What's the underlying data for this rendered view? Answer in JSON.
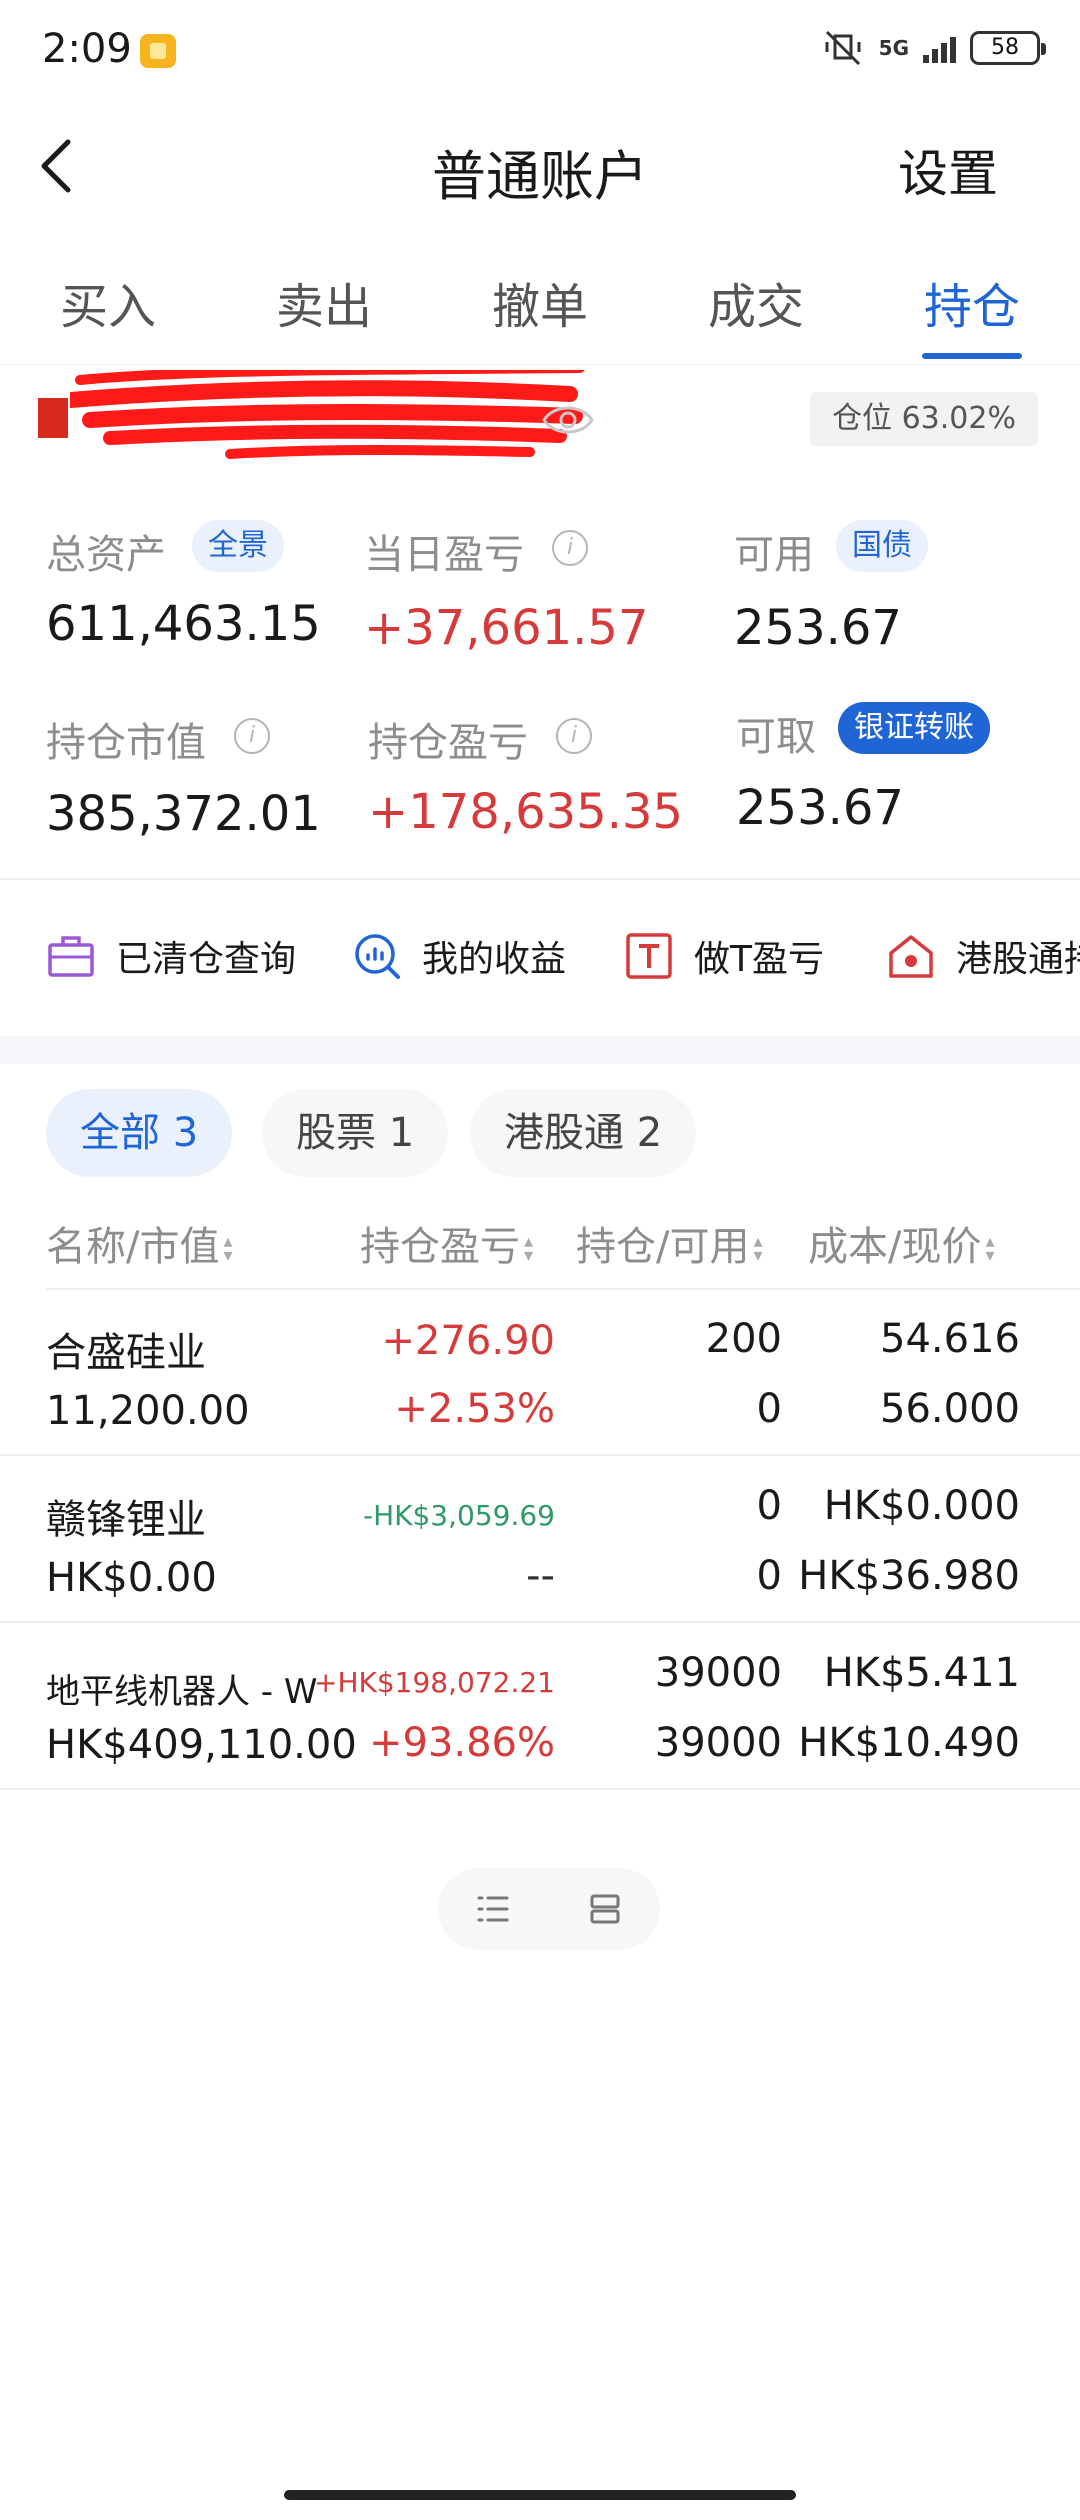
{
  "status_bar": {
    "time": "2:09",
    "network": "5G",
    "battery": "58"
  },
  "header": {
    "title": "普通账户",
    "settings_label": "设置"
  },
  "tabs": [
    {
      "label": "买入"
    },
    {
      "label": "卖出"
    },
    {
      "label": "撤单"
    },
    {
      "label": "成交"
    },
    {
      "label": "持仓",
      "active": true
    }
  ],
  "account": {
    "position_ratio": "仓位 63.02%"
  },
  "summary": {
    "total_assets": {
      "label": "总资产",
      "tag": "全景",
      "value": "611,463.15"
    },
    "daily_pnl": {
      "label": "当日盈亏",
      "value": "+37,661.57"
    },
    "available": {
      "label": "可用",
      "tag": "国债",
      "value": "253.67"
    },
    "market_value": {
      "label": "持仓市值",
      "value": "385,372.01"
    },
    "position_pnl": {
      "label": "持仓盈亏",
      "value": "+178,635.35"
    },
    "withdrawable": {
      "label": "可取",
      "tag": "银证转账",
      "value": "253.67"
    }
  },
  "quick_actions": [
    {
      "label": "已清仓查询",
      "icon": "briefcase-icon",
      "color": "#9b59d9"
    },
    {
      "label": "我的收益",
      "icon": "chart-search-icon",
      "color": "#1f65d6"
    },
    {
      "label": "做T盈亏",
      "icon": "t-box-icon",
      "color": "#d63a3a"
    },
    {
      "label": "港股通持",
      "icon": "hk-house-icon",
      "color": "#d63a3a"
    }
  ],
  "filters": [
    {
      "label": "全部 3",
      "active": true
    },
    {
      "label": "股票 1"
    },
    {
      "label": "港股通 2"
    }
  ],
  "table": {
    "headers": [
      "名称/市值",
      "持仓盈亏",
      "持仓/可用",
      "成本/现价"
    ],
    "rows": [
      {
        "name": "合盛硅业",
        "market_value": "11,200.00",
        "pnl": "+276.90",
        "pnl_pct": "+2.53%",
        "position": "200",
        "available": "0",
        "cost": "54.616",
        "price": "56.000",
        "trend": "up"
      },
      {
        "name": "赣锋锂业",
        "market_value": "HK$0.00",
        "pnl": "-HK$3,059.69",
        "pnl_pct": "--",
        "position": "0",
        "available": "0",
        "cost": "HK$0.000",
        "price": "HK$36.980",
        "trend": "down"
      },
      {
        "name": "地平线机器人 - W",
        "market_value": "HK$409,110.00",
        "pnl": "+HK$198,072.21",
        "pnl_pct": "+93.86%",
        "position": "39000",
        "available": "39000",
        "cost": "HK$5.411",
        "price": "HK$10.490",
        "trend": "up"
      }
    ]
  },
  "colors": {
    "accent": "#1f65d6",
    "up": "#d63a3a",
    "down": "#2e9a66"
  }
}
